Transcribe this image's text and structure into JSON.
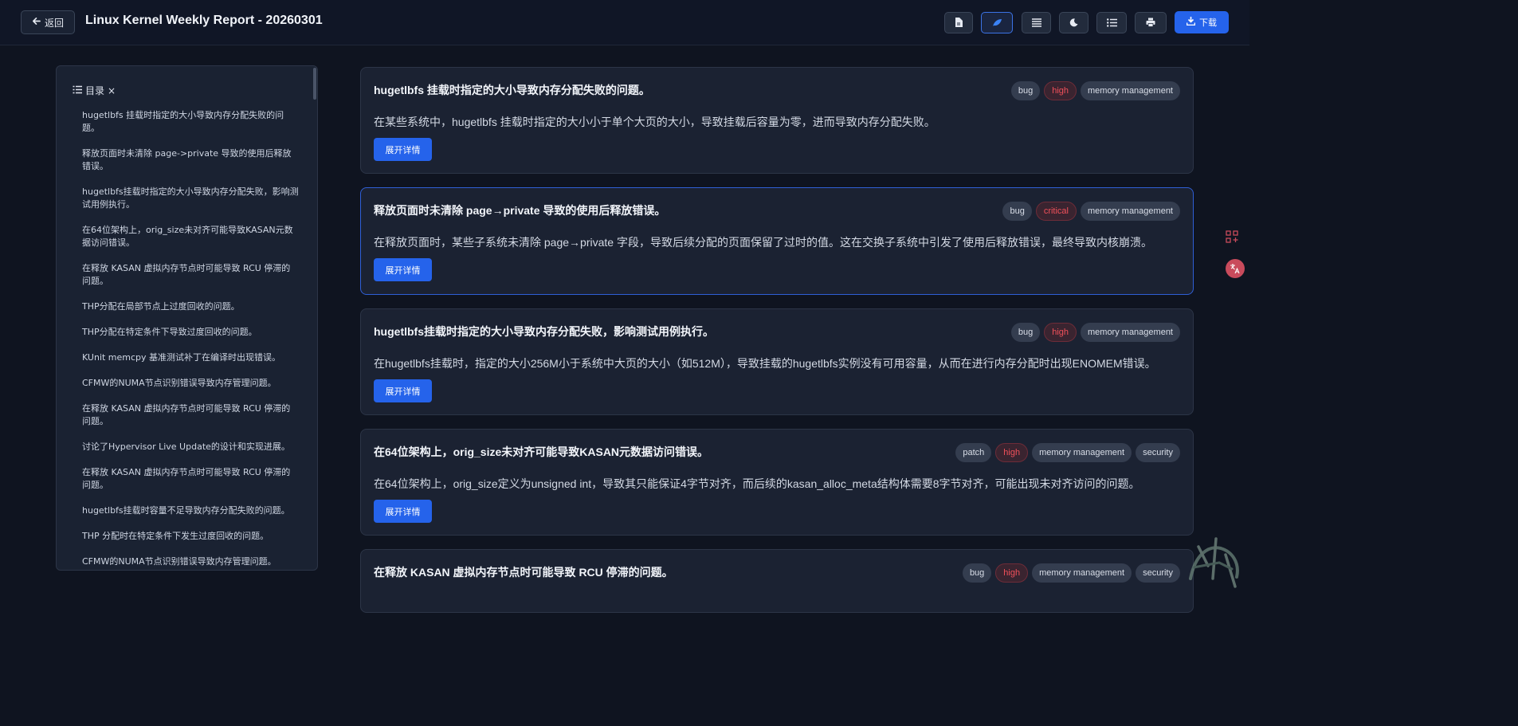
{
  "header": {
    "back_label": "返回",
    "title": "Linux Kernel Weekly Report - 20260301",
    "download_label": "下载",
    "toolbar_icons": [
      "document-icon",
      "leaf-icon",
      "align-justify-icon",
      "moon-icon",
      "list-icon",
      "print-icon"
    ]
  },
  "toc": {
    "heading": "目录",
    "close": "×",
    "items": [
      "hugetlbfs 挂载时指定的大小导致内存分配失败的问题。",
      "释放页面时未清除 page->private 导致的使用后释放错误。",
      "hugetlbfs挂载时指定的大小导致内存分配失败，影响测试用例执行。",
      "在64位架构上，orig_size未对齐可能导致KASAN元数据访问错误。",
      "在释放 KASAN 虚拟内存节点时可能导致 RCU 停滞的问题。",
      "THP分配在局部节点上过度回收的问题。",
      "THP分配在特定条件下导致过度回收的问题。",
      "KUnit memcpy 基准测试补丁在编译时出现错误。",
      "CFMW的NUMA节点识别错误导致内存管理问题。",
      "在释放 KASAN 虚拟内存节点时可能导致 RCU 停滞的问题。",
      "讨论了Hypervisor Live Update的设计和实现进展。",
      "在释放 KASAN 虚拟内存节点时可能导致 RCU 停滞的问题。",
      "hugetlbfs挂载时容量不足导致内存分配失败的问题。",
      "THP 分配时在特定条件下发生过度回收的问题。",
      "CFMW的NUMA节点识别错误导致内存管理问题。"
    ]
  },
  "expand_label": "展开详情",
  "cards": [
    {
      "title": "hugetlbfs 挂载时指定的大小导致内存分配失败的问题。",
      "desc": "在某些系统中，hugetlbfs 挂载时指定的大小小于单个大页的大小，导致挂载后容量为零，进而导致内存分配失败。",
      "tags": [
        "bug",
        "high",
        "memory management"
      ]
    },
    {
      "title": "释放页面时未清除 page→private 导致的使用后释放错误。",
      "desc": "在释放页面时，某些子系统未清除 page→private 字段，导致后续分配的页面保留了过时的值。这在交换子系统中引发了使用后释放错误，最终导致内核崩溃。",
      "tags": [
        "bug",
        "critical",
        "memory management"
      ]
    },
    {
      "title": "hugetlbfs挂载时指定的大小导致内存分配失败，影响测试用例执行。",
      "desc": "在hugetlbfs挂载时，指定的大小256M小于系统中大页的大小（如512M），导致挂载的hugetlbfs实例没有可用容量，从而在进行内存分配时出现ENOMEM错误。",
      "tags": [
        "bug",
        "high",
        "memory management"
      ]
    },
    {
      "title": "在64位架构上，orig_size未对齐可能导致KASAN元数据访问错误。",
      "desc": "在64位架构上，orig_size定义为unsigned int，导致其只能保证4字节对齐，而后续的kasan_alloc_meta结构体需要8字节对齐，可能出现未对齐访问的问题。",
      "tags": [
        "patch",
        "high",
        "memory management",
        "security"
      ]
    },
    {
      "title": "在释放 KASAN 虚拟内存节点时可能导致 RCU 停滞的问题。",
      "desc": "",
      "tags": [
        "bug",
        "high",
        "memory management",
        "security"
      ]
    }
  ],
  "colors": {
    "accent": "#2563eb",
    "severity": "#f0505a",
    "background": "#0f1420",
    "card": "#1b2232"
  }
}
